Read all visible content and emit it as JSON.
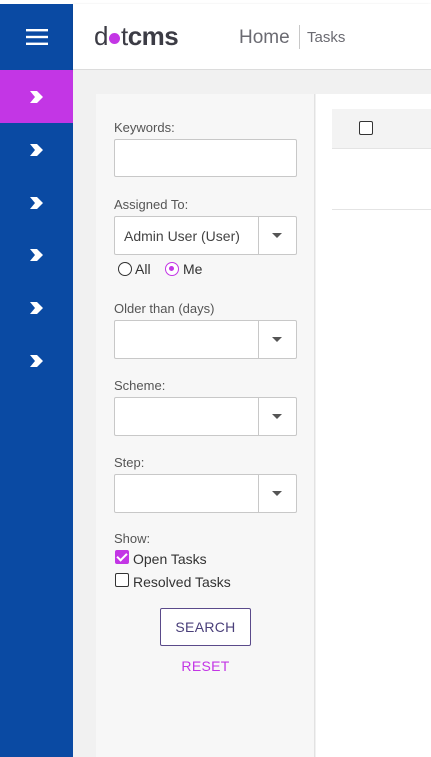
{
  "header": {
    "logo": {
      "pre": "d",
      "post": "t",
      "brand": "cms"
    },
    "breadcrumb": {
      "home": "Home",
      "current": "Tasks"
    }
  },
  "sidebar": {
    "items": [
      {
        "icon": "chevron-right-icon",
        "active": true
      },
      {
        "icon": "chevron-right-icon",
        "active": false
      },
      {
        "icon": "chevron-right-icon",
        "active": false
      },
      {
        "icon": "chevron-right-icon",
        "active": false
      },
      {
        "icon": "chevron-right-icon",
        "active": false
      },
      {
        "icon": "chevron-right-icon",
        "active": false
      }
    ]
  },
  "filters": {
    "keywords": {
      "label": "Keywords:",
      "value": ""
    },
    "assigned_to": {
      "label": "Assigned To:",
      "value": "Admin User (User)"
    },
    "scope": {
      "all": "All",
      "me": "Me",
      "selected": "me"
    },
    "older_than": {
      "label": "Older than (days)",
      "value": ""
    },
    "scheme": {
      "label": "Scheme:",
      "value": ""
    },
    "step": {
      "label": "Step:",
      "value": ""
    },
    "show": {
      "label": "Show:",
      "open_tasks": "Open Tasks",
      "resolved_tasks": "Resolved Tasks",
      "open_checked": true,
      "resolved_checked": false
    },
    "search_label": "SEARCH",
    "reset_label": "RESET"
  },
  "colors": {
    "sidebar": "#0a4aa3",
    "accent": "#c336e5"
  }
}
